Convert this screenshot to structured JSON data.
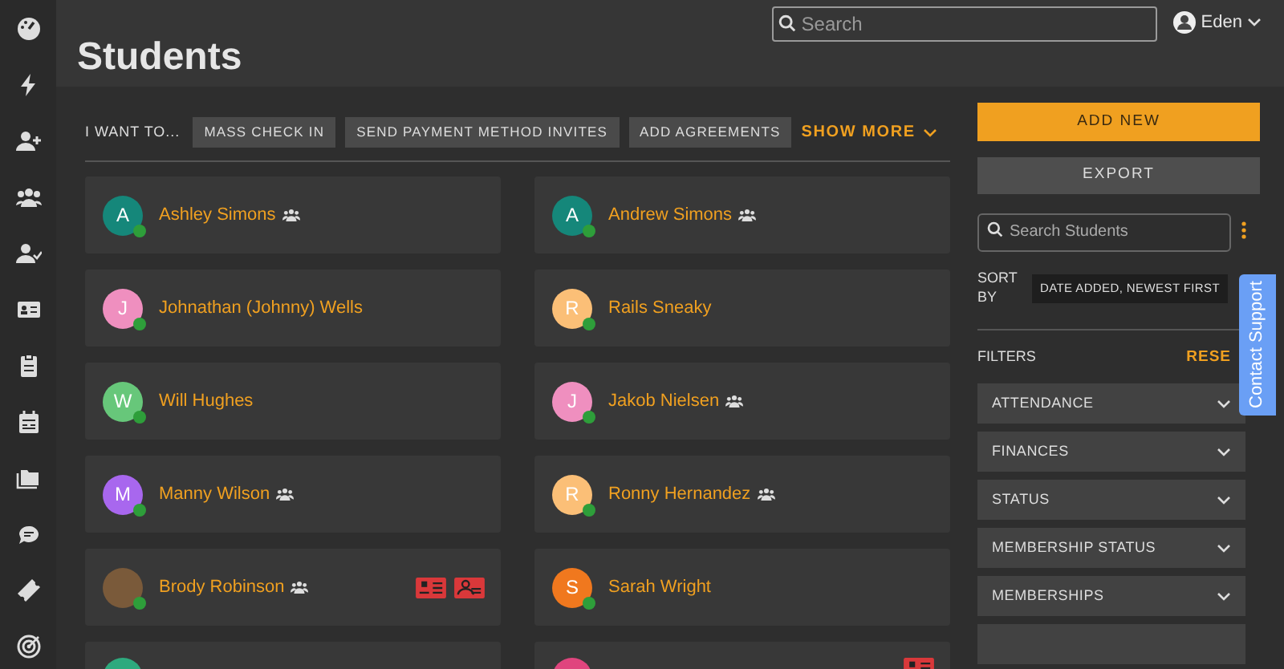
{
  "header": {
    "title": "Students",
    "search": {
      "placeholder": "Search"
    },
    "user": "Eden"
  },
  "actions": {
    "label": "I WANT TO...",
    "buttons": [
      "MASS CHECK IN",
      "SEND PAYMENT METHOD INVITES",
      "ADD AGREEMENTS"
    ],
    "show_more": "SHOW MORE"
  },
  "students": [
    {
      "kind": "initial",
      "initial": "A",
      "name": "Ashley Simons",
      "color": "#15877a",
      "family": true,
      "online": true
    },
    {
      "kind": "initial",
      "initial": "A",
      "name": "Andrew Simons",
      "color": "#15877a",
      "family": true,
      "online": true
    },
    {
      "kind": "initial",
      "initial": "J",
      "name": "Johnathan (Johnny) Wells",
      "color": "#ef8fbf",
      "family": false,
      "online": true
    },
    {
      "kind": "initial",
      "initial": "R",
      "name": "Rails Sneaky",
      "color": "#fbbf77",
      "family": false,
      "online": true
    },
    {
      "kind": "initial",
      "initial": "W",
      "name": "Will Hughes",
      "color": "#67c77a",
      "family": false,
      "online": true
    },
    {
      "kind": "initial",
      "initial": "J",
      "name": "Jakob Nielsen",
      "color": "#ef8fbf",
      "family": true,
      "online": true
    },
    {
      "kind": "initial",
      "initial": "M",
      "name": "Manny Wilson",
      "color": "#a867ee",
      "family": true,
      "online": true
    },
    {
      "kind": "initial",
      "initial": "R",
      "name": "Ronny Hernandez",
      "color": "#fbbf77",
      "family": true,
      "online": true
    },
    {
      "kind": "photo",
      "name": "Brody Robinson",
      "family": true,
      "online": true,
      "flags": [
        {
          "kind": "id"
        },
        {
          "kind": "payment"
        }
      ]
    },
    {
      "kind": "initial",
      "initial": "S",
      "name": "Sarah Wright",
      "color": "#f0781e",
      "family": false,
      "online": true
    },
    {
      "kind": "partial",
      "color": "#2eaa7e"
    },
    {
      "kind": "partial",
      "color": "#e0457e",
      "flags": [
        {
          "kind": "id"
        }
      ]
    }
  ],
  "panel": {
    "add_new": "ADD NEW",
    "export": "EXPORT",
    "search": {
      "placeholder": "Search Students"
    },
    "sort_label": "SORT BY",
    "sort_value": "DATE ADDED, NEWEST FIRST",
    "filters_label": "FILTERS",
    "reset": "RESE",
    "filters": [
      {
        "label": "ATTENDANCE"
      },
      {
        "label": "FINANCES"
      },
      {
        "label": "STATUS"
      },
      {
        "label": "MEMBERSHIP STATUS"
      },
      {
        "label": "MEMBERSHIPS"
      },
      {
        "kind": "partial"
      }
    ]
  },
  "support": "Contact Support"
}
